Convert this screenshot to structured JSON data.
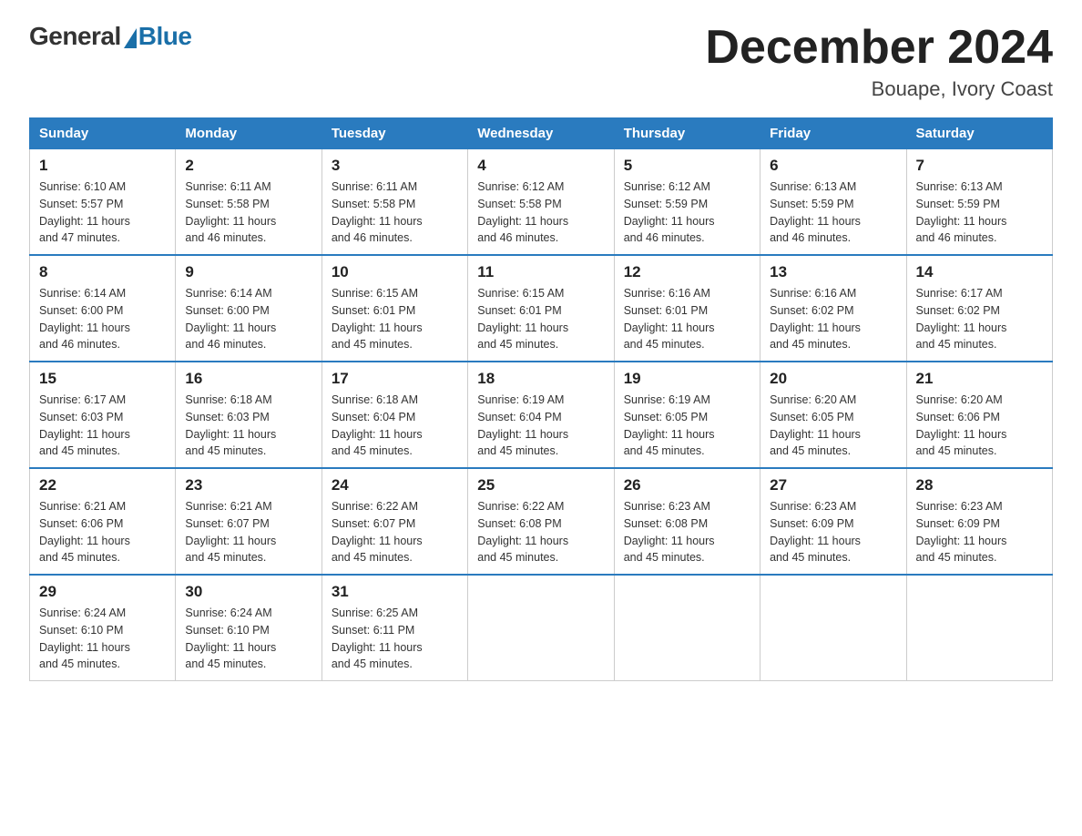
{
  "logo": {
    "general": "General",
    "blue": "Blue",
    "subtitle": "Blue"
  },
  "title": "December 2024",
  "location": "Bouape, Ivory Coast",
  "days_of_week": [
    "Sunday",
    "Monday",
    "Tuesday",
    "Wednesday",
    "Thursday",
    "Friday",
    "Saturday"
  ],
  "weeks": [
    [
      {
        "num": "1",
        "sunrise": "6:10 AM",
        "sunset": "5:57 PM",
        "daylight": "11 hours and 47 minutes."
      },
      {
        "num": "2",
        "sunrise": "6:11 AM",
        "sunset": "5:58 PM",
        "daylight": "11 hours and 46 minutes."
      },
      {
        "num": "3",
        "sunrise": "6:11 AM",
        "sunset": "5:58 PM",
        "daylight": "11 hours and 46 minutes."
      },
      {
        "num": "4",
        "sunrise": "6:12 AM",
        "sunset": "5:58 PM",
        "daylight": "11 hours and 46 minutes."
      },
      {
        "num": "5",
        "sunrise": "6:12 AM",
        "sunset": "5:59 PM",
        "daylight": "11 hours and 46 minutes."
      },
      {
        "num": "6",
        "sunrise": "6:13 AM",
        "sunset": "5:59 PM",
        "daylight": "11 hours and 46 minutes."
      },
      {
        "num": "7",
        "sunrise": "6:13 AM",
        "sunset": "5:59 PM",
        "daylight": "11 hours and 46 minutes."
      }
    ],
    [
      {
        "num": "8",
        "sunrise": "6:14 AM",
        "sunset": "6:00 PM",
        "daylight": "11 hours and 46 minutes."
      },
      {
        "num": "9",
        "sunrise": "6:14 AM",
        "sunset": "6:00 PM",
        "daylight": "11 hours and 46 minutes."
      },
      {
        "num": "10",
        "sunrise": "6:15 AM",
        "sunset": "6:01 PM",
        "daylight": "11 hours and 45 minutes."
      },
      {
        "num": "11",
        "sunrise": "6:15 AM",
        "sunset": "6:01 PM",
        "daylight": "11 hours and 45 minutes."
      },
      {
        "num": "12",
        "sunrise": "6:16 AM",
        "sunset": "6:01 PM",
        "daylight": "11 hours and 45 minutes."
      },
      {
        "num": "13",
        "sunrise": "6:16 AM",
        "sunset": "6:02 PM",
        "daylight": "11 hours and 45 minutes."
      },
      {
        "num": "14",
        "sunrise": "6:17 AM",
        "sunset": "6:02 PM",
        "daylight": "11 hours and 45 minutes."
      }
    ],
    [
      {
        "num": "15",
        "sunrise": "6:17 AM",
        "sunset": "6:03 PM",
        "daylight": "11 hours and 45 minutes."
      },
      {
        "num": "16",
        "sunrise": "6:18 AM",
        "sunset": "6:03 PM",
        "daylight": "11 hours and 45 minutes."
      },
      {
        "num": "17",
        "sunrise": "6:18 AM",
        "sunset": "6:04 PM",
        "daylight": "11 hours and 45 minutes."
      },
      {
        "num": "18",
        "sunrise": "6:19 AM",
        "sunset": "6:04 PM",
        "daylight": "11 hours and 45 minutes."
      },
      {
        "num": "19",
        "sunrise": "6:19 AM",
        "sunset": "6:05 PM",
        "daylight": "11 hours and 45 minutes."
      },
      {
        "num": "20",
        "sunrise": "6:20 AM",
        "sunset": "6:05 PM",
        "daylight": "11 hours and 45 minutes."
      },
      {
        "num": "21",
        "sunrise": "6:20 AM",
        "sunset": "6:06 PM",
        "daylight": "11 hours and 45 minutes."
      }
    ],
    [
      {
        "num": "22",
        "sunrise": "6:21 AM",
        "sunset": "6:06 PM",
        "daylight": "11 hours and 45 minutes."
      },
      {
        "num": "23",
        "sunrise": "6:21 AM",
        "sunset": "6:07 PM",
        "daylight": "11 hours and 45 minutes."
      },
      {
        "num": "24",
        "sunrise": "6:22 AM",
        "sunset": "6:07 PM",
        "daylight": "11 hours and 45 minutes."
      },
      {
        "num": "25",
        "sunrise": "6:22 AM",
        "sunset": "6:08 PM",
        "daylight": "11 hours and 45 minutes."
      },
      {
        "num": "26",
        "sunrise": "6:23 AM",
        "sunset": "6:08 PM",
        "daylight": "11 hours and 45 minutes."
      },
      {
        "num": "27",
        "sunrise": "6:23 AM",
        "sunset": "6:09 PM",
        "daylight": "11 hours and 45 minutes."
      },
      {
        "num": "28",
        "sunrise": "6:23 AM",
        "sunset": "6:09 PM",
        "daylight": "11 hours and 45 minutes."
      }
    ],
    [
      {
        "num": "29",
        "sunrise": "6:24 AM",
        "sunset": "6:10 PM",
        "daylight": "11 hours and 45 minutes."
      },
      {
        "num": "30",
        "sunrise": "6:24 AM",
        "sunset": "6:10 PM",
        "daylight": "11 hours and 45 minutes."
      },
      {
        "num": "31",
        "sunrise": "6:25 AM",
        "sunset": "6:11 PM",
        "daylight": "11 hours and 45 minutes."
      },
      null,
      null,
      null,
      null
    ]
  ],
  "labels": {
    "sunrise": "Sunrise:",
    "sunset": "Sunset:",
    "daylight": "Daylight:"
  }
}
